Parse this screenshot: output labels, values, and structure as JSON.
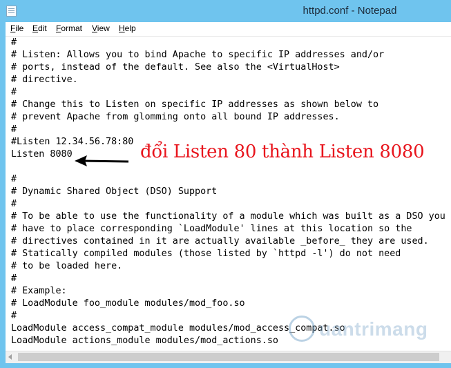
{
  "window": {
    "title": "httpd.conf - Notepad"
  },
  "menu": {
    "items": [
      {
        "key": "F",
        "rest": "ile"
      },
      {
        "key": "E",
        "rest": "dit"
      },
      {
        "key": "F",
        "rest": "ormat",
        "pre": ""
      },
      {
        "key": "V",
        "rest": "iew"
      },
      {
        "key": "H",
        "rest": "elp"
      }
    ]
  },
  "editor": {
    "lines": [
      "#",
      "# Listen: Allows you to bind Apache to specific IP addresses and/or",
      "# ports, instead of the default. See also the <VirtualHost>",
      "# directive.",
      "#",
      "# Change this to Listen on specific IP addresses as shown below to",
      "# prevent Apache from glomming onto all bound IP addresses.",
      "#",
      "#Listen 12.34.56.78:80",
      "Listen 8080",
      "",
      "#",
      "# Dynamic Shared Object (DSO) Support",
      "#",
      "# To be able to use the functionality of a module which was built as a DSO you",
      "# have to place corresponding `LoadModule' lines at this location so the",
      "# directives contained in it are actually available _before_ they are used.",
      "# Statically compiled modules (those listed by `httpd -l') do not need",
      "# to be loaded here.",
      "#",
      "# Example:",
      "# LoadModule foo_module modules/mod_foo.so",
      "#",
      "LoadModule access_compat_module modules/mod_access_compat.so",
      "LoadModule actions_module modules/mod_actions.so"
    ]
  },
  "annotation": {
    "text": "đổi Listen 80 thành Listen 8080",
    "color": "#e8141c"
  },
  "watermark": {
    "text": "uantrimang"
  },
  "colors": {
    "frame": "#6fc4ee"
  },
  "icons": {
    "app": "notepad-icon",
    "arrow": "left-arrow-icon",
    "scroll_left": "scroll-left-arrow-icon"
  }
}
